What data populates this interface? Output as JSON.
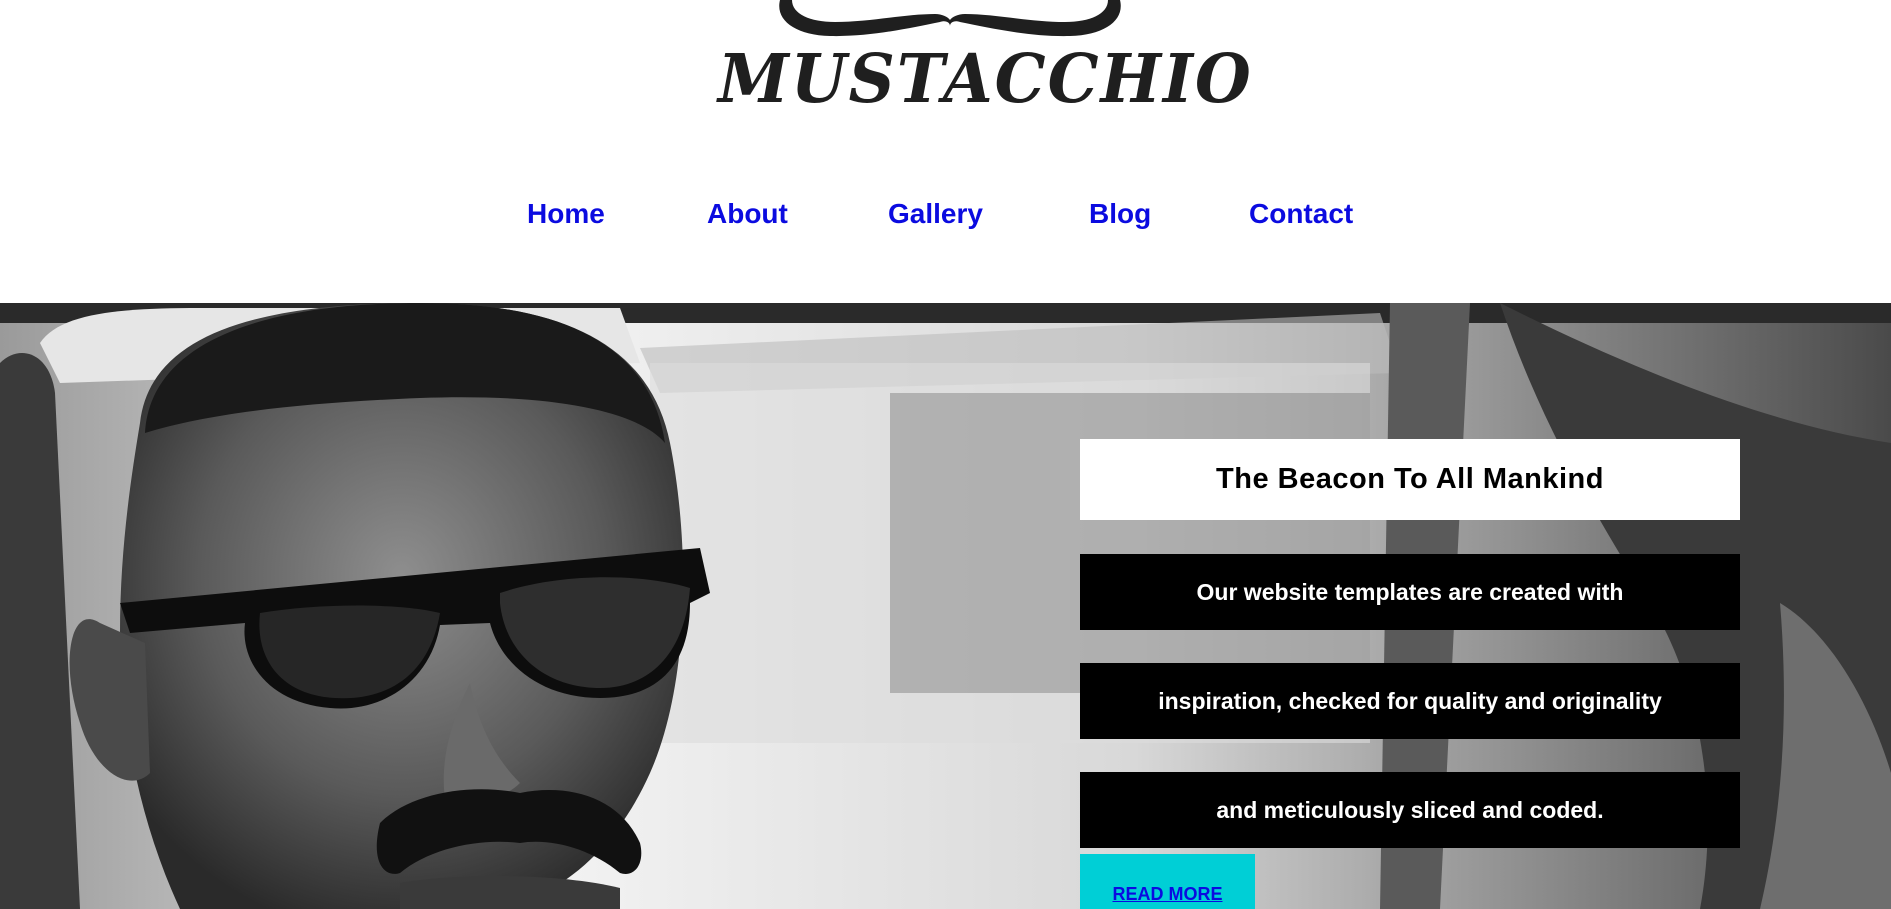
{
  "brand": {
    "logo_text": "MUSTACCHIO",
    "logo_icon": "mustache-icon"
  },
  "nav": {
    "items": [
      {
        "label": "Home"
      },
      {
        "label": "About"
      },
      {
        "label": "Gallery"
      },
      {
        "label": "Blog"
      },
      {
        "label": "Contact"
      }
    ]
  },
  "hero": {
    "title": "The Beacon To All Mankind",
    "lines": [
      "Our website templates are created with",
      "inspiration, checked for quality and originality",
      "and meticulously sliced and coded."
    ],
    "cta_label": "READ MORE",
    "image": "black-and-white photo of a man with sunglasses and mustache in a car"
  },
  "colors": {
    "nav_link": "#0b0be0",
    "cta_background": "#00cfd6",
    "text_box_background": "#000000",
    "title_box_background": "#ffffff"
  }
}
